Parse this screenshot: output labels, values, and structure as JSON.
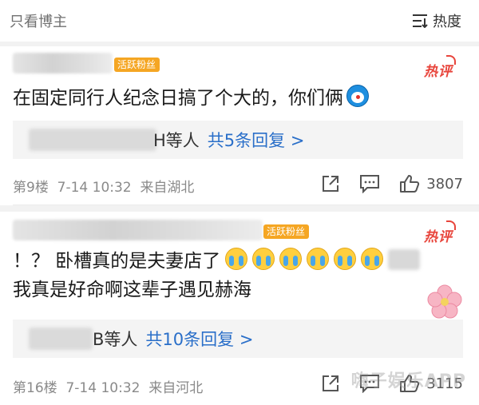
{
  "topbar": {
    "only_op_label": "只看博主",
    "sort_label": "热度"
  },
  "comments": [
    {
      "badge": "活跃粉丝",
      "hot_label": "热评",
      "text": "在固定同行人纪念日搞了个大的，你们俩",
      "emoji": "doraemon-emoji",
      "reply_tail": "H等人",
      "reply_link": "共5条回复 >",
      "floor": "第9楼",
      "time": "7-14 10:32",
      "location": "来自湖北",
      "like_count": "3807"
    },
    {
      "badge": "活跃粉丝",
      "hot_label": "热评",
      "text_line1": "！？ 卧槽真的是夫妻店了",
      "text_line2": "我真是好命啊这辈子遇见赫海",
      "emoji": "crying-emoji",
      "reply_tail": "B等人",
      "reply_link": "共10条回复 >",
      "floor": "第16楼",
      "time": "7-14 10:32",
      "location": "来自河北",
      "like_count": "3115"
    }
  ],
  "watermark": "嗨子娱乐APP",
  "colors": {
    "accent_link": "#2a6fc9",
    "hot_red": "#e8453c",
    "badge_orange": "#f5a623"
  }
}
